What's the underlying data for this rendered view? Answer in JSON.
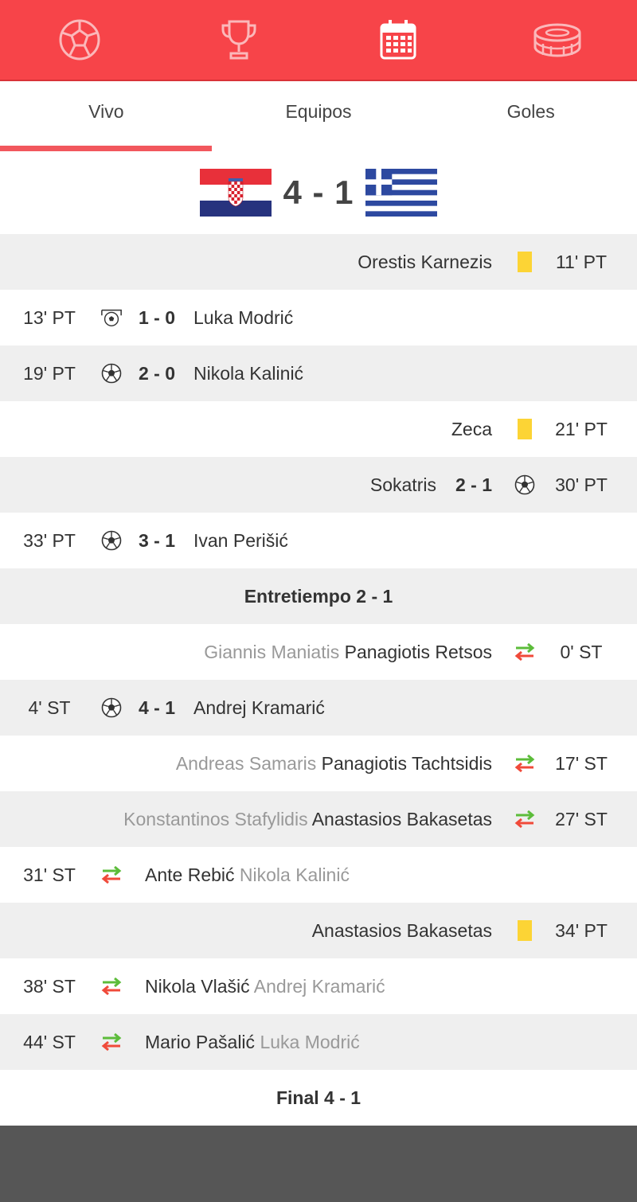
{
  "colors": {
    "accent": "#f74449",
    "card_yellow": "#fcd435",
    "sub_in": "#5cbc3a",
    "sub_out": "#f04a3a",
    "footer": "#565656"
  },
  "topbar": {
    "icons": [
      "soccer-ball-icon",
      "trophy-icon",
      "calendar-icon",
      "stadium-icon"
    ],
    "active": "calendar-icon"
  },
  "tabs": [
    {
      "label": "Vivo",
      "active": true
    },
    {
      "label": "Equipos",
      "active": false
    },
    {
      "label": "Goles",
      "active": false
    }
  ],
  "match": {
    "home_flag": "croatia-flag",
    "away_flag": "greece-flag",
    "score": "4 - 1"
  },
  "events": [
    {
      "side": "right",
      "time": "11' PT",
      "type": "yellow-card",
      "player": "Orestis Karnezis"
    },
    {
      "side": "left",
      "time": "13' PT",
      "type": "penalty-goal",
      "score": "1 - 0",
      "player": "Luka Modrić"
    },
    {
      "side": "left",
      "time": "19' PT",
      "type": "goal",
      "score": "2 - 0",
      "player": "Nikola Kalinić"
    },
    {
      "side": "right",
      "time": "21' PT",
      "type": "yellow-card",
      "player": "Zeca"
    },
    {
      "side": "right",
      "time": "30' PT",
      "type": "goal",
      "score": "2 - 1",
      "player": "Sokatris"
    },
    {
      "side": "left",
      "time": "33' PT",
      "type": "goal",
      "score": "3 - 1",
      "player": "Ivan Perišić"
    },
    {
      "type": "separator",
      "text": "Entretiempo 2 - 1"
    },
    {
      "side": "right",
      "time": "0' ST",
      "type": "substitution",
      "player_out": "Giannis Maniatis",
      "player_in": "Panagiotis Retsos"
    },
    {
      "side": "left",
      "time": "4' ST",
      "type": "goal",
      "score": "4 - 1",
      "player": "Andrej Kramarić"
    },
    {
      "side": "right",
      "time": "17' ST",
      "type": "substitution",
      "player_out": "Andreas Samaris",
      "player_in": "Panagiotis Tachtsidis"
    },
    {
      "side": "right",
      "time": "27' ST",
      "type": "substitution",
      "player_out": "Konstantinos Stafylidis",
      "player_in": "Anastasios Bakasetas"
    },
    {
      "side": "left",
      "time": "31' ST",
      "type": "substitution",
      "player_in": "Ante Rebić",
      "player_out": "Nikola Kalinić"
    },
    {
      "side": "right",
      "time": "34' PT",
      "type": "yellow-card",
      "player": "Anastasios Bakasetas"
    },
    {
      "side": "left",
      "time": "38' ST",
      "type": "substitution",
      "player_in": "Nikola Vlašić",
      "player_out": "Andrej Kramarić"
    },
    {
      "side": "left",
      "time": "44' ST",
      "type": "substitution",
      "player_in": "Mario Pašalić",
      "player_out": "Luka Modrić"
    },
    {
      "type": "separator",
      "text": "Final 4 - 1"
    }
  ]
}
